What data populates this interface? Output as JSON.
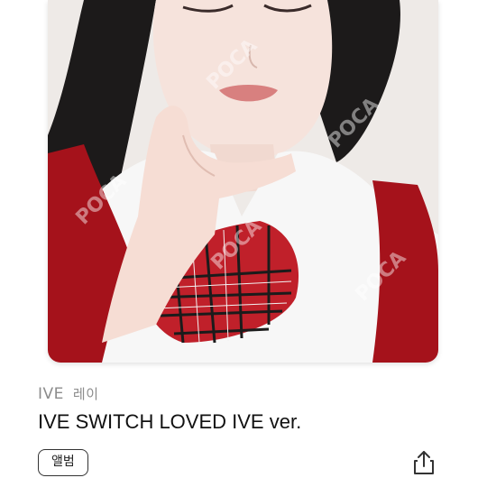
{
  "item": {
    "group": "IVE",
    "member": "레이",
    "title": "IVE SWITCH LOVED IVE ver.",
    "tag": "앨범",
    "watermark": "POCA"
  },
  "icons": {
    "share": "share-icon"
  },
  "colors": {
    "uniform_red": "#b0141c",
    "meta_gray": "#8c8c8c",
    "title_black": "#111111"
  }
}
